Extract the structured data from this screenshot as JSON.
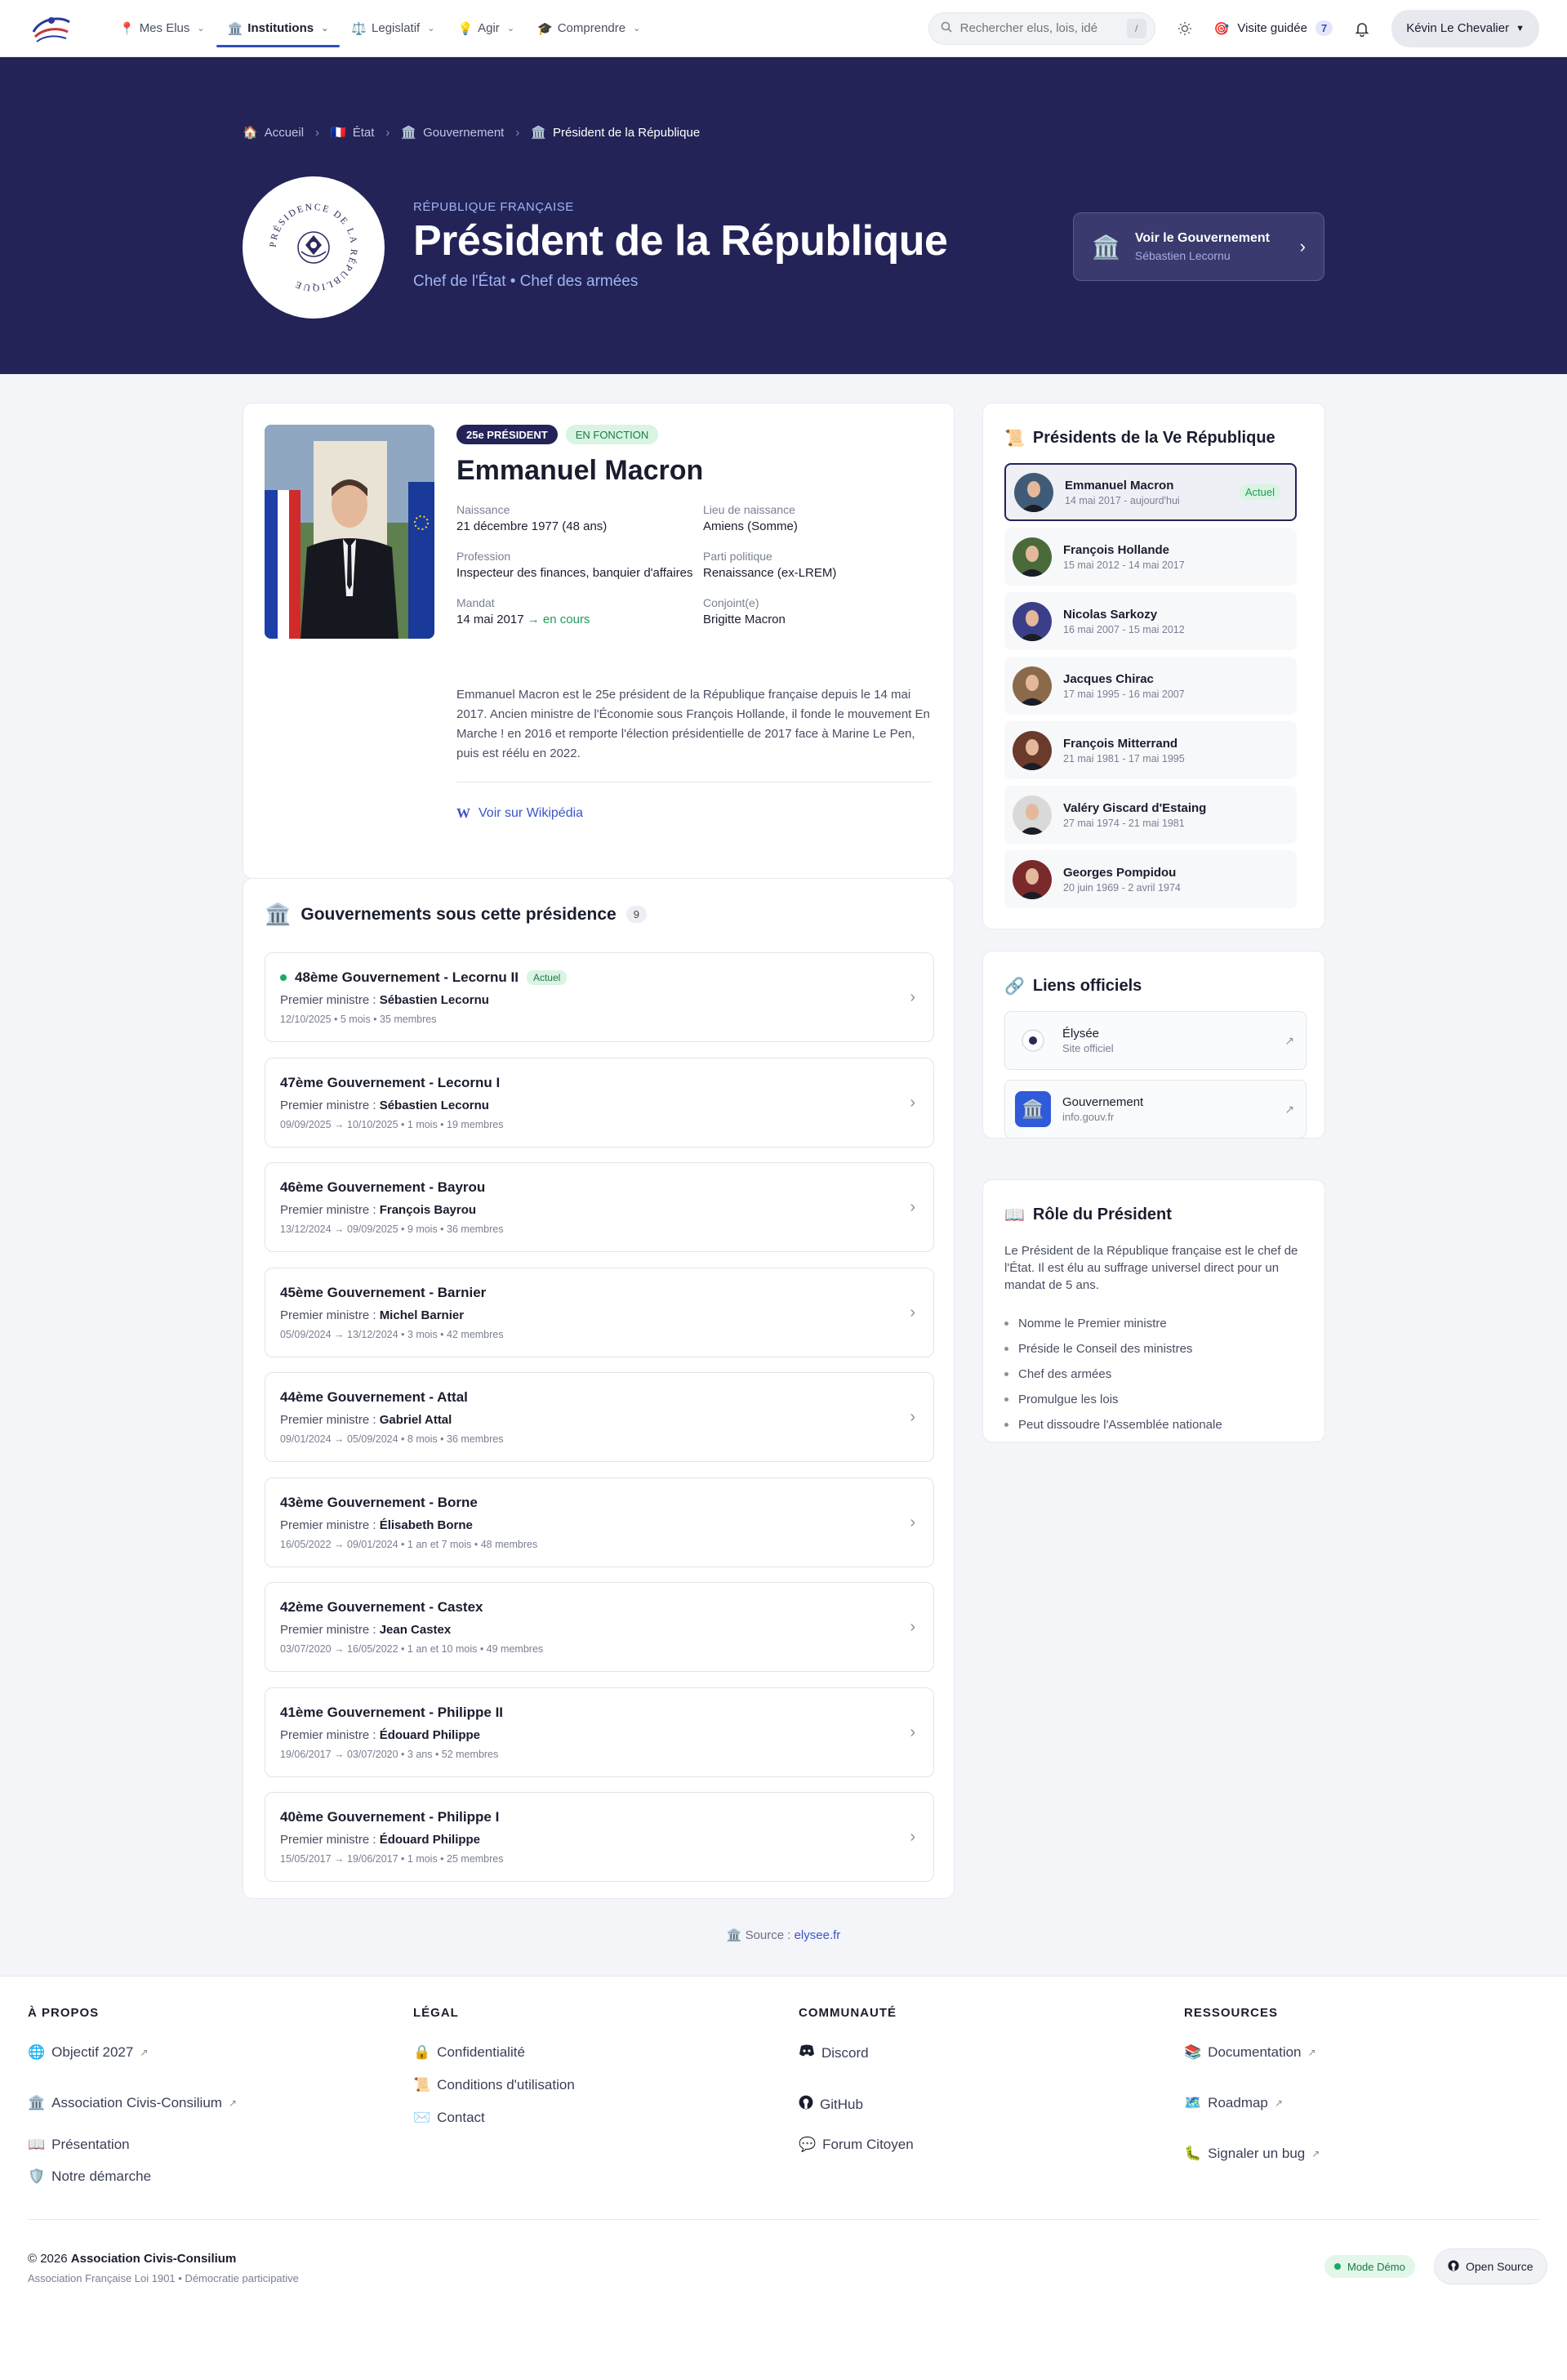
{
  "nav": {
    "items": [
      {
        "icon": "📍",
        "label": "Mes Elus"
      },
      {
        "icon": "🏛️",
        "label": "Institutions"
      },
      {
        "icon": "⚖️",
        "label": "Legislatif"
      },
      {
        "icon": "💡",
        "label": "Agir"
      },
      {
        "icon": "🎓",
        "label": "Comprendre"
      }
    ],
    "search_placeholder": "Rechercher elus, lois, idé",
    "search_shortcut": "/",
    "tour_label": "Visite guidée",
    "tour_count": "7",
    "user_name": "Kévin Le Chevalier"
  },
  "hero": {
    "breadcrumb": [
      {
        "icon": "🏠",
        "label": "Accueil"
      },
      {
        "icon": "🇫🇷",
        "label": "État"
      },
      {
        "icon": "🏛️",
        "label": "Gouvernement"
      },
      {
        "icon": "🏛️",
        "label": "Président de la République"
      }
    ],
    "supertitle": "RÉPUBLIQUE FRANÇAISE",
    "title": "Président de la République",
    "subtitle": "Chef de l'État • Chef des armées",
    "gov_link_title": "Voir le Gouvernement",
    "gov_link_sub": "Sébastien Lecornu",
    "emblem_text": "PRÉSIDENCE DE LA RÉPUBLIQUE"
  },
  "president": {
    "tag_rank": "25e PRÉSIDENT",
    "tag_status": "EN FONCTION",
    "name": "Emmanuel Macron",
    "facts": [
      {
        "label": "Naissance",
        "value": "21 décembre 1977 (48 ans)"
      },
      {
        "label": "Lieu de naissance",
        "value": "Amiens (Somme)"
      },
      {
        "label": "Profession",
        "value": "Inspecteur des finances, banquier d'affaires"
      },
      {
        "label": "Parti politique",
        "value": "Renaissance (ex-LREM)"
      },
      {
        "label": "Mandat",
        "value": "14 mai 2017",
        "extra": "→ en cours"
      },
      {
        "label": "Conjoint(e)",
        "value": "Brigitte Macron"
      }
    ],
    "bio": "Emmanuel Macron est le 25e président de la République française depuis le 14 mai 2017. Ancien ministre de l'Économie sous François Hollande, il fonde le mouvement En Marche ! en 2016 et remporte l'élection présidentielle de 2017 face à Marine Le Pen, puis est réélu en 2022.",
    "wiki_label": "Voir sur Wikipédia"
  },
  "governments": {
    "title": "Gouvernements sous cette présidence",
    "count": "9",
    "pm_prefix": "Premier ministre : ",
    "current_label": "Actuel",
    "items": [
      {
        "name": "48ème Gouvernement - Lecornu II",
        "pm": "Sébastien Lecornu",
        "meta": "12/10/2025 • 5 mois • 35 membres",
        "current": true
      },
      {
        "name": "47ème Gouvernement - Lecornu I",
        "pm": "Sébastien Lecornu",
        "meta": "09/09/2025 → 10/10/2025 • 1 mois • 19 membres"
      },
      {
        "name": "46ème Gouvernement - Bayrou",
        "pm": "François Bayrou",
        "meta": "13/12/2024 → 09/09/2025 • 9 mois • 36 membres"
      },
      {
        "name": "45ème Gouvernement - Barnier",
        "pm": "Michel Barnier",
        "meta": "05/09/2024 → 13/12/2024 • 3 mois • 42 membres"
      },
      {
        "name": "44ème Gouvernement - Attal",
        "pm": "Gabriel Attal",
        "meta": "09/01/2024 → 05/09/2024 • 8 mois • 36 membres"
      },
      {
        "name": "43ème Gouvernement - Borne",
        "pm": "Élisabeth Borne",
        "meta": "16/05/2022 → 09/01/2024 • 1 an et 7 mois • 48 membres"
      },
      {
        "name": "42ème Gouvernement - Castex",
        "pm": "Jean Castex",
        "meta": "03/07/2020 → 16/05/2022 • 1 an et 10 mois • 49 membres"
      },
      {
        "name": "41ème Gouvernement - Philippe II",
        "pm": "Édouard Philippe",
        "meta": "19/06/2017 → 03/07/2020 • 3 ans • 52 membres"
      },
      {
        "name": "40ème Gouvernement - Philippe I",
        "pm": "Édouard Philippe",
        "meta": "15/05/2017 → 19/06/2017 • 1 mois • 25 membres"
      }
    ]
  },
  "presidents": {
    "title": "Présidents de la Ve République",
    "current_label": "Actuel",
    "items": [
      {
        "name": "Emmanuel Macron",
        "dates": "14 mai 2017 - aujourd'hui",
        "current": true,
        "bg": "#3f5b78"
      },
      {
        "name": "François Hollande",
        "dates": "15 mai 2012 - 14 mai 2017",
        "bg": "#4a6a3a"
      },
      {
        "name": "Nicolas Sarkozy",
        "dates": "16 mai 2007 - 15 mai 2012",
        "bg": "#3b3f8a"
      },
      {
        "name": "Jacques Chirac",
        "dates": "17 mai 1995 - 16 mai 2007",
        "bg": "#8a6a4a"
      },
      {
        "name": "François Mitterrand",
        "dates": "21 mai 1981 - 17 mai 1995",
        "bg": "#6a3a2a"
      },
      {
        "name": "Valéry Giscard d'Estaing",
        "dates": "27 mai 1974 - 21 mai 1981",
        "bg": "#d9d9d9"
      },
      {
        "name": "Georges Pompidou",
        "dates": "20 juin 1969 - 2 avril 1974",
        "bg": "#7a2a2a"
      }
    ]
  },
  "links": {
    "title": "Liens officiels",
    "items": [
      {
        "name": "Élysée",
        "sub": "Site officiel"
      },
      {
        "name": "Gouvernement",
        "sub": "info.gouv.fr"
      }
    ]
  },
  "role": {
    "title": "Rôle du Président",
    "text": "Le Président de la République française est le chef de l'État. Il est élu au suffrage universel direct pour un mandat de 5 ans.",
    "items": [
      "Nomme le Premier ministre",
      "Préside le Conseil des ministres",
      "Chef des armées",
      "Promulgue les lois",
      "Peut dissoudre l'Assemblée nationale"
    ]
  },
  "source": {
    "prefix": "Source : ",
    "link": "elysee.fr"
  },
  "footer": {
    "cols": [
      {
        "title": "À PROPOS",
        "links": [
          {
            "icon": "🌐",
            "label": "Objectif 2027",
            "ext": true
          },
          {
            "icon": "🏛️",
            "label": "Association Civis-Consilium",
            "ext": true
          },
          {
            "icon": "📖",
            "label": "Présentation"
          },
          {
            "icon": "🛡️",
            "label": "Notre démarche"
          }
        ]
      },
      {
        "title": "LÉGAL",
        "links": [
          {
            "icon": "🔒",
            "label": "Confidentialité"
          },
          {
            "icon": "📜",
            "label": "Conditions d'utilisation"
          },
          {
            "icon": "✉️",
            "label": "Contact"
          }
        ]
      },
      {
        "title": "COMMUNAUTÉ",
        "links": [
          {
            "icon": "discord",
            "label": "Discord"
          },
          {
            "icon": "github",
            "label": "GitHub"
          },
          {
            "icon": "💬",
            "label": "Forum Citoyen"
          }
        ]
      },
      {
        "title": "RESSOURCES",
        "links": [
          {
            "icon": "📚",
            "label": "Documentation",
            "ext": true
          },
          {
            "icon": "🗺️",
            "label": "Roadmap",
            "ext": true
          },
          {
            "icon": "🐛",
            "label": "Signaler un bug",
            "ext": true
          }
        ]
      }
    ],
    "copyright_prefix": "© 2026 ",
    "copyright_org": "Association Civis-Consilium",
    "copyright_sub": "Association Française Loi 1901 • Démocratie participative",
    "demo_label": "Mode Démo",
    "oss_label": "Open Source"
  },
  "colors": {
    "hero_bg": "#232358",
    "accent": "#3a55c8",
    "success": "#1d9c57"
  }
}
